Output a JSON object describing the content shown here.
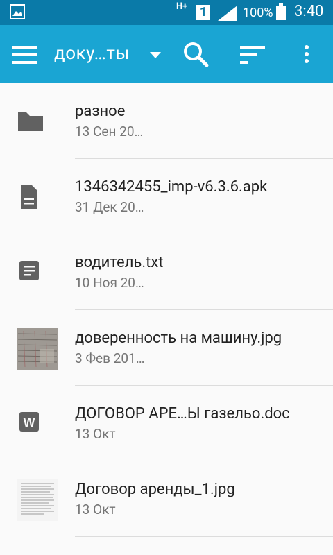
{
  "status_bar": {
    "network_type": "H+",
    "sim": "1",
    "battery_percent": "100%",
    "time": "3:40"
  },
  "app_bar": {
    "title": "доку…ты"
  },
  "files": [
    {
      "name": "разное",
      "date": "13 Сен 20…",
      "icon": "folder-icon"
    },
    {
      "name": "1346342455_imp-v6.3.6.apk",
      "date": "31 Дек 20…",
      "icon": "file-icon"
    },
    {
      "name": "водитель.txt",
      "date": "10 Ноя 20…",
      "icon": "text-file-icon"
    },
    {
      "name": "доверенность на машину.jpg",
      "date": "3 Фев 201…",
      "icon": "image-thumbnail"
    },
    {
      "name": "ДОГОВОР АРЕ…Ы газельо.doc",
      "date": "13 Окт",
      "icon": "word-doc-icon"
    },
    {
      "name": "Договор аренды_1.jpg",
      "date": "13 Окт",
      "icon": "image-thumbnail"
    }
  ],
  "colors": {
    "status_bar": "#0a7aa8",
    "app_bar": "#1aa5d3",
    "icon_gray": "#616161"
  }
}
